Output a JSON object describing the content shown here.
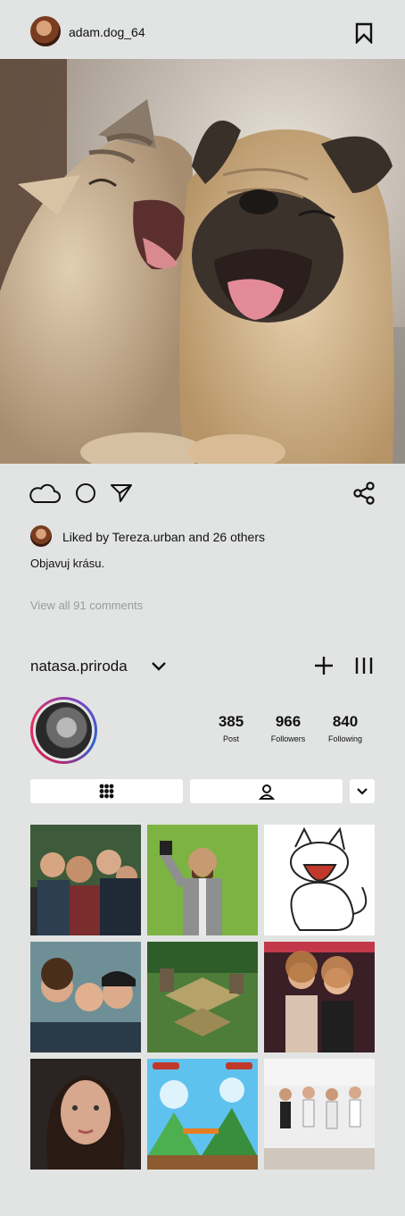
{
  "header": {
    "username": "adam.dog_64"
  },
  "post": {
    "liked_text": "Liked by Tereza.urban and 26 others",
    "caption": "Objavuj krásu.",
    "view_comments": "View all 91 comments"
  },
  "profile": {
    "name": "natasa.priroda",
    "stats": [
      {
        "value": "385",
        "label": "Post"
      },
      {
        "value": "966",
        "label": "Followers"
      },
      {
        "value": "840",
        "label": "Following"
      }
    ]
  },
  "icons": {
    "bookmark": "bookmark-icon",
    "like": "cloud-like-icon",
    "comment": "circle-comment-icon",
    "send": "send-icon",
    "share": "share-icon",
    "add": "plus-icon",
    "menu": "bars-menu-icon",
    "grid": "grid-icon",
    "tagged": "person-icon"
  },
  "colors": {
    "background": "#e2e4e3",
    "story_ring": [
      "#c51f63",
      "#7f3fbf",
      "#2b63d4"
    ]
  }
}
